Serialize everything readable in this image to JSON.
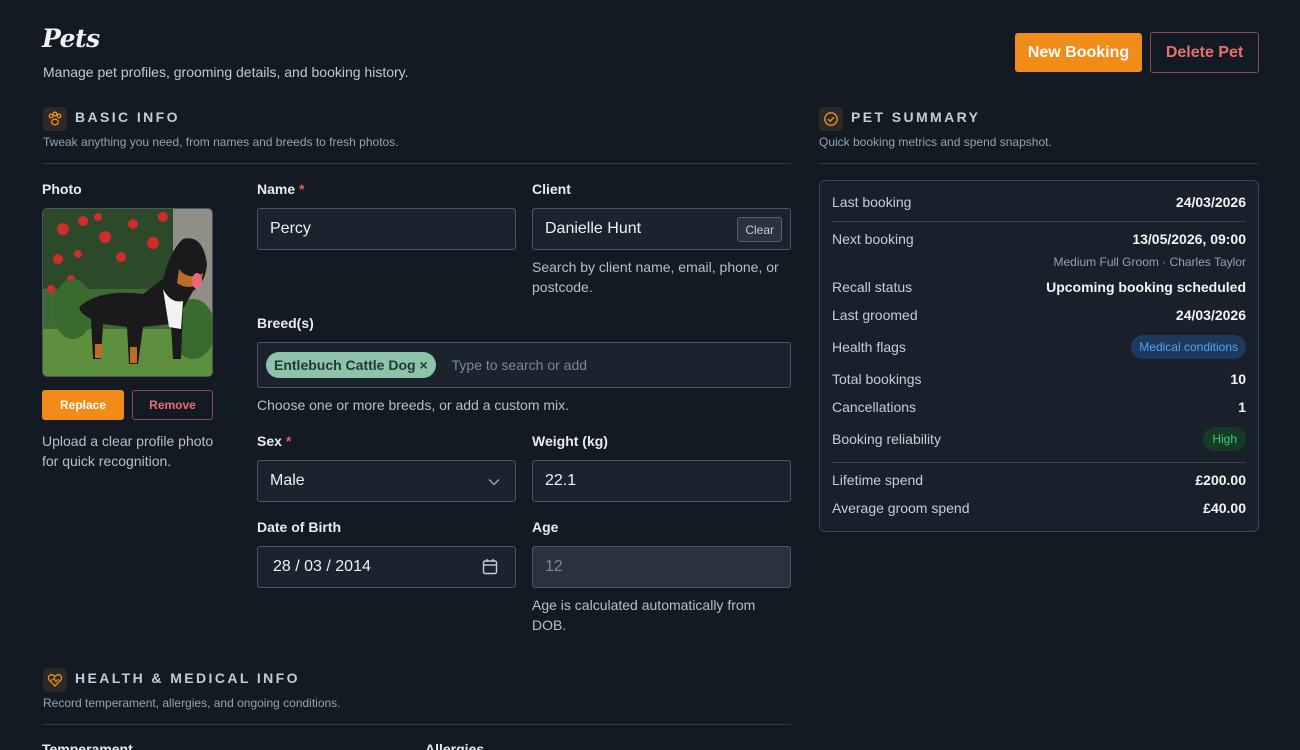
{
  "header": {
    "title": "Pets",
    "subtitle": "Manage pet profiles, grooming details, and booking history.",
    "new_booking_label": "New Booking",
    "delete_pet_label": "Delete Pet"
  },
  "basic_info": {
    "title": "BASIC INFO",
    "description": "Tweak anything you need, from names and breeds to fresh photos.",
    "photo": {
      "label": "Photo",
      "replace_label": "Replace",
      "remove_label": "Remove",
      "help": "Upload a clear profile photo for quick recognition."
    },
    "name": {
      "label": "Name",
      "required": "*",
      "value": "Percy"
    },
    "client": {
      "label": "Client",
      "value": "Danielle Hunt",
      "clear_label": "Clear",
      "help": "Search by client name, email, phone, or postcode."
    },
    "breeds": {
      "label": "Breed(s)",
      "chips": [
        "Entlebuch Cattle Dog ×"
      ],
      "placeholder": "Type to search or add",
      "help": "Choose one or more breeds, or add a custom mix."
    },
    "sex": {
      "label": "Sex",
      "required": "*",
      "value": "Male"
    },
    "weight": {
      "label": "Weight (kg)",
      "value": "22.1"
    },
    "dob": {
      "label": "Date of Birth",
      "value": "28 / 03 / 2014"
    },
    "age": {
      "label": "Age",
      "value": "12",
      "help": "Age is calculated automatically from DOB."
    }
  },
  "health": {
    "title": "HEALTH & MEDICAL INFO",
    "description": "Record temperament, allergies, and ongoing conditions.",
    "temperament_label": "Temperament",
    "allergies_label": "Allergies"
  },
  "summary": {
    "title": "PET SUMMARY",
    "description": "Quick booking metrics and spend snapshot.",
    "last_booking": {
      "label": "Last booking",
      "value": "24/03/2026"
    },
    "next_booking": {
      "label": "Next booking",
      "value": "13/05/2026, 09:00",
      "sub": "Medium Full Groom · Charles Taylor"
    },
    "recall_status": {
      "label": "Recall status",
      "value": "Upcoming booking scheduled"
    },
    "last_groomed": {
      "label": "Last groomed",
      "value": "24/03/2026"
    },
    "health_flags": {
      "label": "Health flags",
      "value": "Medical conditions"
    },
    "total_bookings": {
      "label": "Total bookings",
      "value": "10"
    },
    "cancellations": {
      "label": "Cancellations",
      "value": "1"
    },
    "reliability": {
      "label": "Booking reliability",
      "value": "High"
    },
    "lifetime_spend": {
      "label": "Lifetime spend",
      "value": "£200.00"
    },
    "average_spend": {
      "label": "Average groom spend",
      "value": "£40.00"
    }
  },
  "colors": {
    "background": "#141a24",
    "accent": "#f28c18",
    "danger": "#e5716e",
    "chip": "#8ec3a8",
    "badge_blue": "#4fa3f0",
    "badge_green": "#3ecb74"
  },
  "icons": {
    "basic_info": "paw-icon",
    "summary": "check-circle-icon",
    "health": "heart-pulse-icon",
    "sex_dropdown": "chevron-down-icon",
    "dob": "calendar-icon"
  }
}
